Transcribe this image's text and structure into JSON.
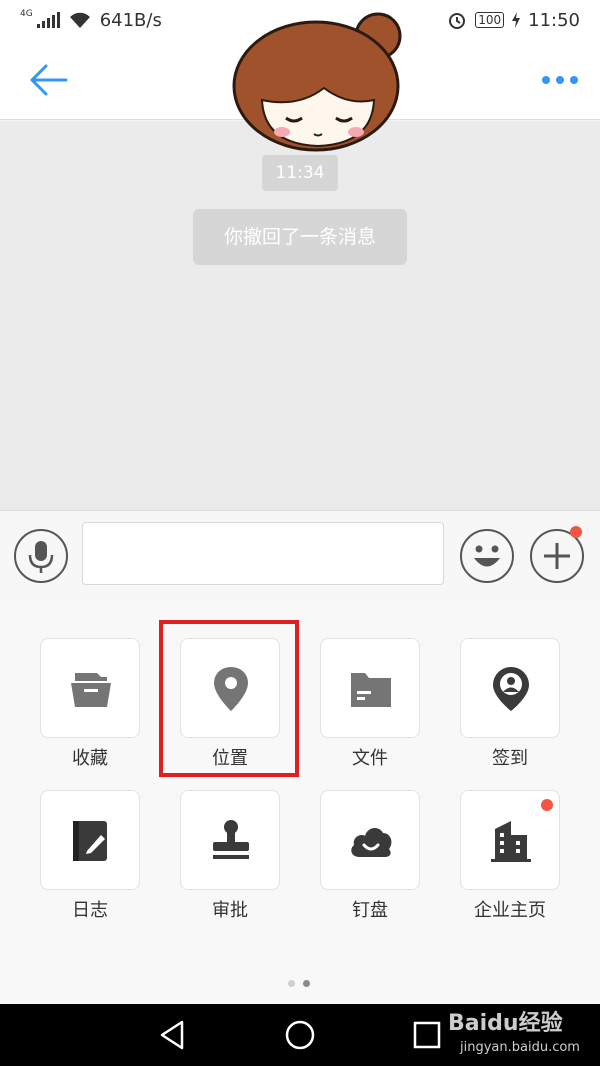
{
  "status": {
    "network_tag": "4G",
    "speed": "641B/s",
    "battery": "100",
    "time": "11:50"
  },
  "header": {
    "back_icon": "arrow-left-icon",
    "more_icon": "more-dots-icon",
    "accent": "#3296FA"
  },
  "chat": {
    "timestamp": "11:34",
    "recall_notice": "你撤回了一条消息"
  },
  "input_bar": {
    "voice_icon": "microphone-icon",
    "emoji_icon": "emoji-smile-icon",
    "plus_icon": "plus-icon",
    "input_value": ""
  },
  "panel": {
    "items": [
      {
        "label": "收藏",
        "icon": "favorites-box-icon"
      },
      {
        "label": "位置",
        "icon": "location-pin-icon",
        "highlighted": true
      },
      {
        "label": "文件",
        "icon": "folder-icon"
      },
      {
        "label": "签到",
        "icon": "checkin-pin-icon"
      },
      {
        "label": "日志",
        "icon": "journal-icon"
      },
      {
        "label": "审批",
        "icon": "stamp-icon"
      },
      {
        "label": "钉盘",
        "icon": "cloud-drive-icon"
      },
      {
        "label": "企业主页",
        "icon": "building-icon",
        "badge": true
      }
    ],
    "page_count": 2,
    "current_page": 2
  },
  "nav": {
    "back_icon": "nav-back-triangle-icon",
    "home_icon": "nav-home-circle-icon",
    "recent_icon": "nav-recent-square-icon"
  },
  "watermark": {
    "brand": "Baidu经验",
    "url": "jingyan.baidu.com"
  },
  "colors": {
    "icon_gray": "#757575",
    "badge_red": "#F25643",
    "highlight_red": "#E02020"
  }
}
